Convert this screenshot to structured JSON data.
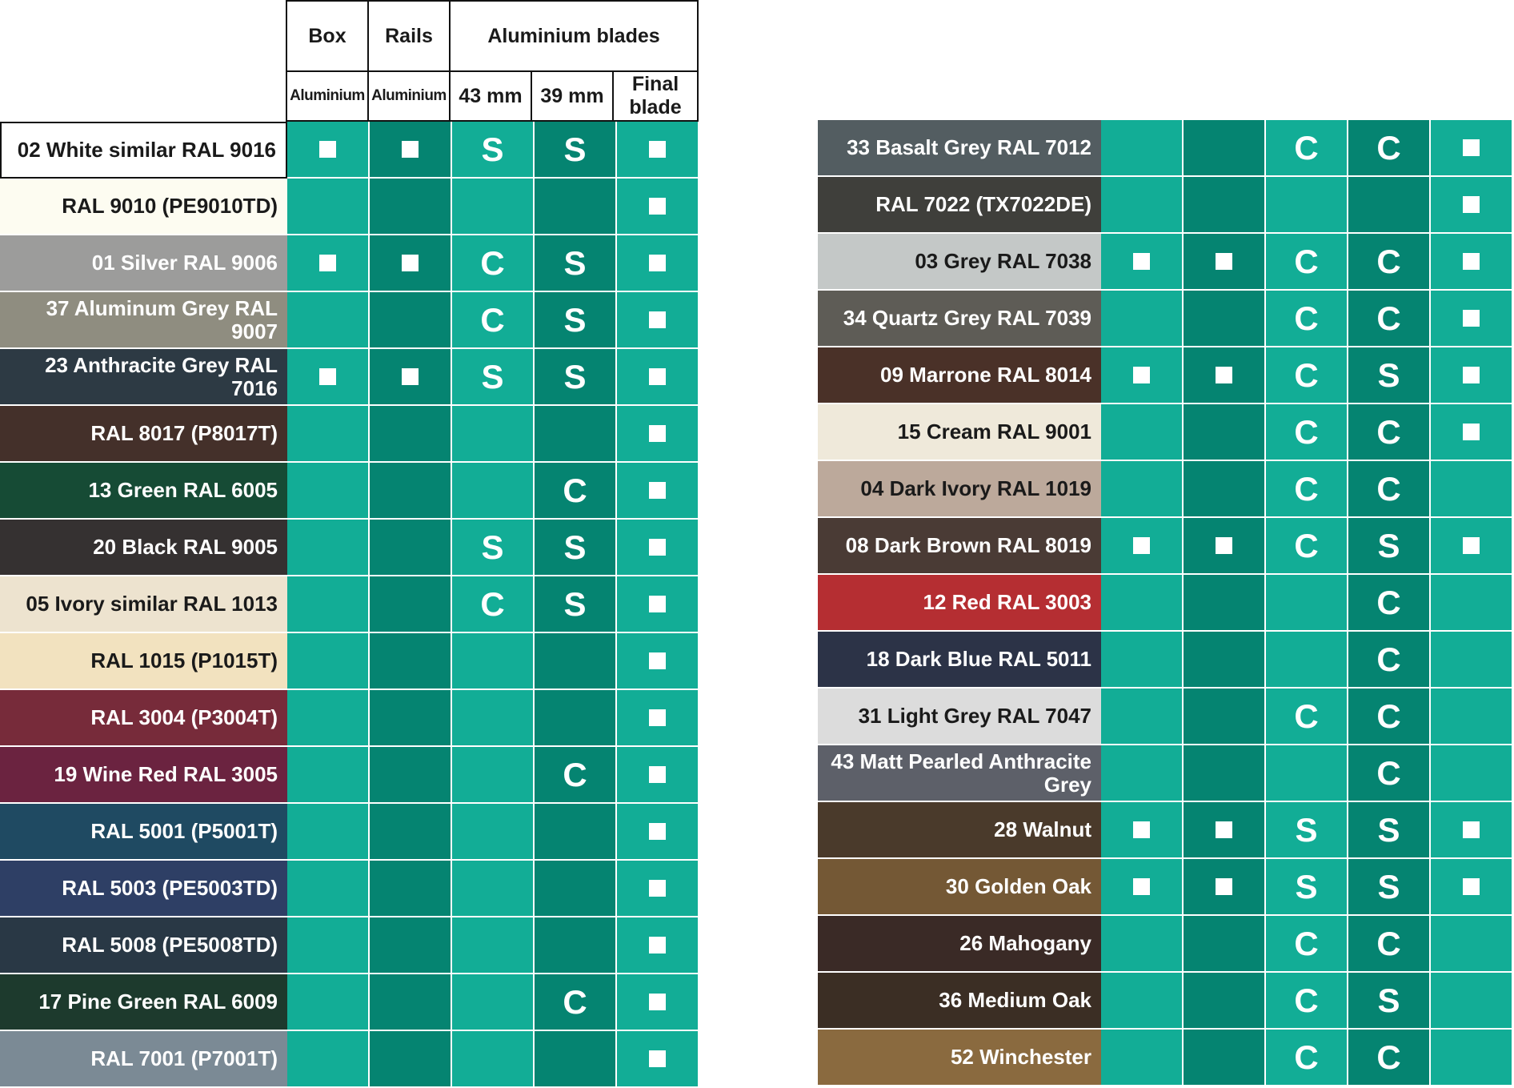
{
  "header": {
    "box": "Box",
    "rails": "Rails",
    "blades": "Aluminium blades",
    "box_material": "Aluminium",
    "rails_material": "Aluminium",
    "blade_43": "43 mm",
    "blade_39": "39 mm",
    "final_blade": "Final blade"
  },
  "square_symbol": "■",
  "colors": {
    "teal_light": "#12ad96",
    "teal_dark": "#058471"
  },
  "left_rows": [
    {
      "name": "02 White similar RAL 9016",
      "swatch": "#ffffff",
      "text_color": "#1a1a1a",
      "box": "■",
      "rails": "■",
      "b43": "S",
      "b39": "S",
      "final": "■"
    },
    {
      "name": "RAL 9010 (PE9010TD)",
      "swatch": "#fdfcf1",
      "text_color": "#1a1a1a",
      "box": "",
      "rails": "",
      "b43": "",
      "b39": "",
      "final": "■"
    },
    {
      "name": "01 Silver RAL 9006",
      "swatch": "#9c9c9b",
      "text_color": "#ffffff",
      "box": "■",
      "rails": "■",
      "b43": "C",
      "b39": "S",
      "final": "■"
    },
    {
      "name": "37 Aluminum Grey RAL 9007",
      "swatch": "#8f8d80",
      "text_color": "#ffffff",
      "box": "",
      "rails": "",
      "b43": "C",
      "b39": "S",
      "final": "■"
    },
    {
      "name": "23 Anthracite Grey RAL 7016",
      "swatch": "#2d3a44",
      "text_color": "#ffffff",
      "box": "■",
      "rails": "■",
      "b43": "S",
      "b39": "S",
      "final": "■"
    },
    {
      "name": "RAL 8017 (P8017T)",
      "swatch": "#44302a",
      "text_color": "#ffffff",
      "box": "",
      "rails": "",
      "b43": "",
      "b39": "",
      "final": "■"
    },
    {
      "name": "13 Green RAL 6005",
      "swatch": "#164b35",
      "text_color": "#ffffff",
      "box": "",
      "rails": "",
      "b43": "",
      "b39": "C",
      "final": "■"
    },
    {
      "name": "20 Black RAL 9005",
      "swatch": "#353131",
      "text_color": "#ffffff",
      "box": "",
      "rails": "",
      "b43": "S",
      "b39": "S",
      "final": "■"
    },
    {
      "name": "05 Ivory similar RAL 1013",
      "swatch": "#ede3cf",
      "text_color": "#1a1a1a",
      "box": "",
      "rails": "",
      "b43": "C",
      "b39": "S",
      "final": "■"
    },
    {
      "name": "RAL 1015 (P1015T)",
      "swatch": "#f2e2bf",
      "text_color": "#1a1a1a",
      "box": "",
      "rails": "",
      "b43": "",
      "b39": "",
      "final": "■"
    },
    {
      "name": "RAL 3004 (P3004T)",
      "swatch": "#772b3a",
      "text_color": "#ffffff",
      "box": "",
      "rails": "",
      "b43": "",
      "b39": "",
      "final": "■"
    },
    {
      "name": "19 Wine Red RAL 3005",
      "swatch": "#6b2340",
      "text_color": "#ffffff",
      "box": "",
      "rails": "",
      "b43": "",
      "b39": "C",
      "final": "■"
    },
    {
      "name": "RAL 5001 (P5001T)",
      "swatch": "#1f4a62",
      "text_color": "#ffffff",
      "box": "",
      "rails": "",
      "b43": "",
      "b39": "",
      "final": "■"
    },
    {
      "name": "RAL 5003 (PE5003TD)",
      "swatch": "#2e3f65",
      "text_color": "#ffffff",
      "box": "",
      "rails": "",
      "b43": "",
      "b39": "",
      "final": "■"
    },
    {
      "name": "RAL 5008 (PE5008TD)",
      "swatch": "#293845",
      "text_color": "#ffffff",
      "box": "",
      "rails": "",
      "b43": "",
      "b39": "",
      "final": "■"
    },
    {
      "name": "17 Pine Green RAL 6009",
      "swatch": "#1d3a2d",
      "text_color": "#ffffff",
      "box": "",
      "rails": "",
      "b43": "",
      "b39": "C",
      "final": "■"
    },
    {
      "name": "RAL 7001 (P7001T)",
      "swatch": "#7b8a95",
      "text_color": "#ffffff",
      "box": "",
      "rails": "",
      "b43": "",
      "b39": "",
      "final": "■"
    }
  ],
  "right_rows": [
    {
      "name": "33 Basalt Grey RAL 7012",
      "swatch": "#535d61",
      "text_color": "#ffffff",
      "box": "",
      "rails": "",
      "b43": "C",
      "b39": "C",
      "final": "■"
    },
    {
      "name": "RAL 7022 (TX7022DE)",
      "swatch": "#3f3f3b",
      "text_color": "#ffffff",
      "box": "",
      "rails": "",
      "b43": "",
      "b39": "",
      "final": "■"
    },
    {
      "name": "03 Grey RAL 7038",
      "swatch": "#c4c8c7",
      "text_color": "#1a1a1a",
      "box": "■",
      "rails": "■",
      "b43": "C",
      "b39": "C",
      "final": "■"
    },
    {
      "name": "34 Quartz Grey RAL 7039",
      "swatch": "#5e5c56",
      "text_color": "#ffffff",
      "box": "",
      "rails": "",
      "b43": "C",
      "b39": "C",
      "final": "■"
    },
    {
      "name": "09 Marrone RAL 8014",
      "swatch": "#4a3128",
      "text_color": "#ffffff",
      "box": "■",
      "rails": "■",
      "b43": "C",
      "b39": "S",
      "final": "■"
    },
    {
      "name": "15 Cream RAL 9001",
      "swatch": "#efe9da",
      "text_color": "#1a1a1a",
      "box": "",
      "rails": "",
      "b43": "C",
      "b39": "C",
      "final": "■"
    },
    {
      "name": "04 Dark Ivory RAL 1019",
      "swatch": "#bca99b",
      "text_color": "#1a1a1a",
      "box": "",
      "rails": "",
      "b43": "C",
      "b39": "C",
      "final": ""
    },
    {
      "name": "08 Dark Brown RAL 8019",
      "swatch": "#4a3b35",
      "text_color": "#ffffff",
      "box": "■",
      "rails": "■",
      "b43": "C",
      "b39": "S",
      "final": "■"
    },
    {
      "name": "12 Red RAL 3003",
      "swatch": "#b52e32",
      "text_color": "#ffffff",
      "box": "",
      "rails": "",
      "b43": "",
      "b39": "C",
      "final": ""
    },
    {
      "name": "18 Dark Blue RAL 5011",
      "swatch": "#2c3347",
      "text_color": "#ffffff",
      "box": "",
      "rails": "",
      "b43": "",
      "b39": "C",
      "final": ""
    },
    {
      "name": "31 Light Grey RAL 7047",
      "swatch": "#dcdcdc",
      "text_color": "#1a1a1a",
      "box": "",
      "rails": "",
      "b43": "C",
      "b39": "C",
      "final": ""
    },
    {
      "name": "43 Matt Pearled Anthracite Grey",
      "swatch": "#5d6069",
      "text_color": "#ffffff",
      "box": "",
      "rails": "",
      "b43": "",
      "b39": "C",
      "final": ""
    },
    {
      "name": "28 Walnut",
      "swatch": "#4a3a2b",
      "text_color": "#ffffff",
      "box": "■",
      "rails": "■",
      "b43": "S",
      "b39": "S",
      "final": "■"
    },
    {
      "name": "30 Golden Oak",
      "swatch": "#745835",
      "text_color": "#ffffff",
      "box": "■",
      "rails": "■",
      "b43": "S",
      "b39": "S",
      "final": "■"
    },
    {
      "name": "26 Mahogany",
      "swatch": "#3a2a26",
      "text_color": "#ffffff",
      "box": "",
      "rails": "",
      "b43": "C",
      "b39": "C",
      "final": ""
    },
    {
      "name": "36 Medium Oak",
      "swatch": "#3b2e24",
      "text_color": "#ffffff",
      "box": "",
      "rails": "",
      "b43": "C",
      "b39": "S",
      "final": ""
    },
    {
      "name": "52 Winchester",
      "swatch": "#8a6a3f",
      "text_color": "#ffffff",
      "box": "",
      "rails": "",
      "b43": "C",
      "b39": "C",
      "final": ""
    }
  ]
}
